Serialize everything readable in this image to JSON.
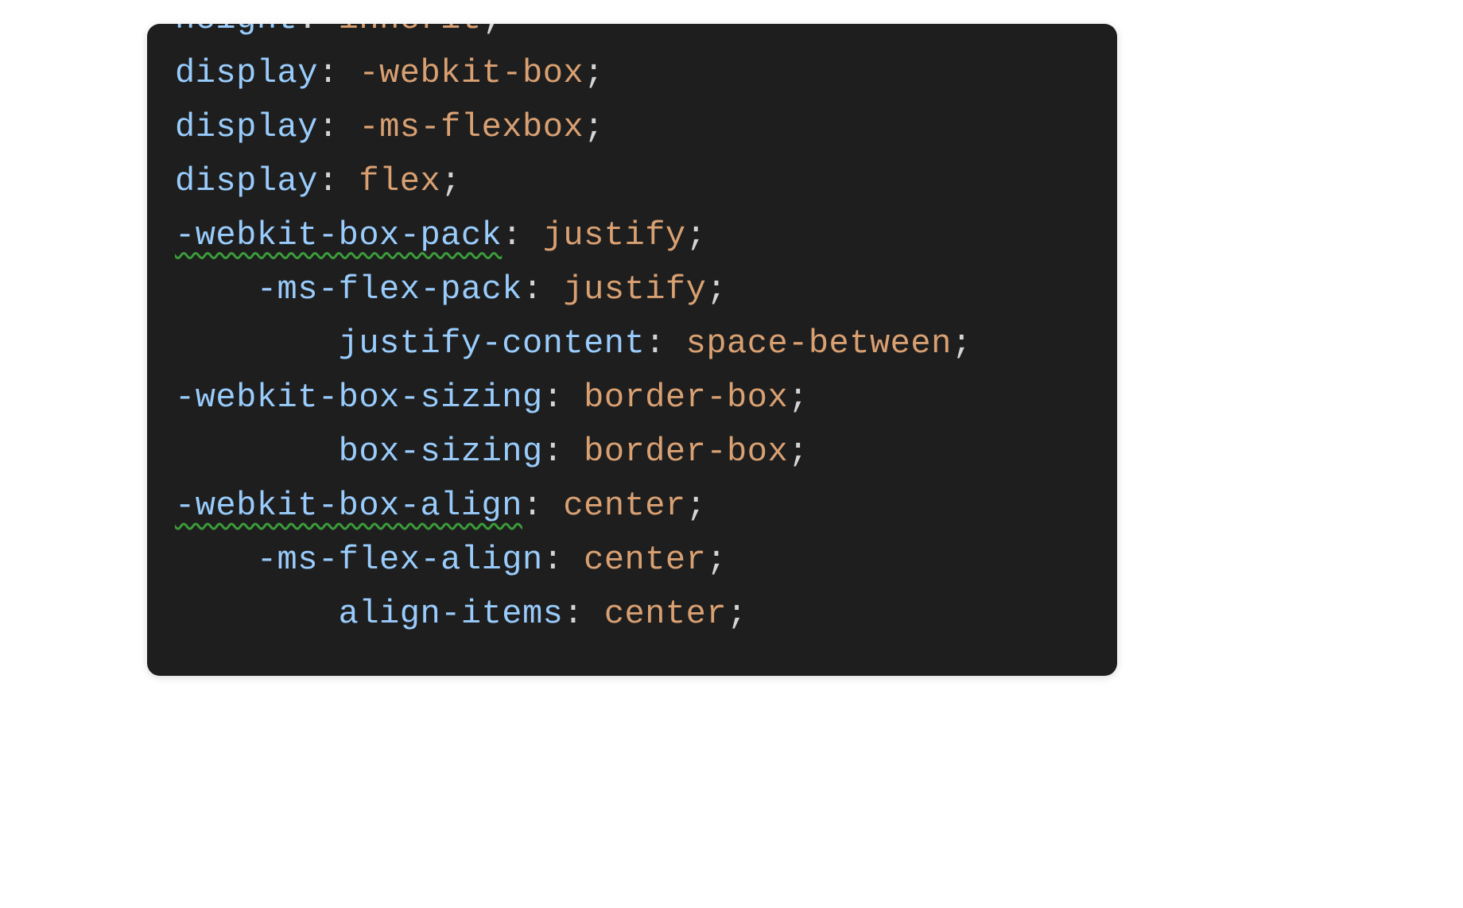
{
  "colors": {
    "background": "#1e1e1e",
    "property": "#99ccfc",
    "value": "#d9a072",
    "punctuation": "#d4d4d4",
    "indentGuide": "#3a3a3a",
    "squiggle": "#3a9c3a"
  },
  "code": {
    "lines": [
      {
        "indent": "",
        "property": "height",
        "colon": ": ",
        "value": "inherit",
        "semicolon": ";",
        "squiggle": false
      },
      {
        "indent": "",
        "property": "display",
        "colon": ": ",
        "value": "-webkit-box",
        "semicolon": ";",
        "squiggle": false
      },
      {
        "indent": "",
        "property": "display",
        "colon": ": ",
        "value": "-ms-flexbox",
        "semicolon": ";",
        "squiggle": false
      },
      {
        "indent": "",
        "property": "display",
        "colon": ": ",
        "value": "flex",
        "semicolon": ";",
        "squiggle": false
      },
      {
        "indent": "",
        "property": "-webkit-box-pack",
        "colon": ": ",
        "value": "justify",
        "semicolon": ";",
        "squiggle": true
      },
      {
        "indent": "    ",
        "property": "-ms-flex-pack",
        "colon": ": ",
        "value": "justify",
        "semicolon": ";",
        "squiggle": false
      },
      {
        "indent": "        ",
        "property": "justify-content",
        "colon": ": ",
        "value": "space-between",
        "semicolon": ";",
        "squiggle": false
      },
      {
        "indent": "",
        "property": "-webkit-box-sizing",
        "colon": ": ",
        "value": "border-box",
        "semicolon": ";",
        "squiggle": false
      },
      {
        "indent": "        ",
        "property": "box-sizing",
        "colon": ": ",
        "value": "border-box",
        "semicolon": ";",
        "squiggle": false
      },
      {
        "indent": "",
        "property": "-webkit-box-align",
        "colon": ": ",
        "value": "center",
        "semicolon": ";",
        "squiggle": true
      },
      {
        "indent": "    ",
        "property": "-ms-flex-align",
        "colon": ": ",
        "value": "center",
        "semicolon": ";",
        "squiggle": false
      },
      {
        "indent": "        ",
        "property": "align-items",
        "colon": ": ",
        "value": "center",
        "semicolon": ";",
        "squiggle": false
      }
    ]
  }
}
